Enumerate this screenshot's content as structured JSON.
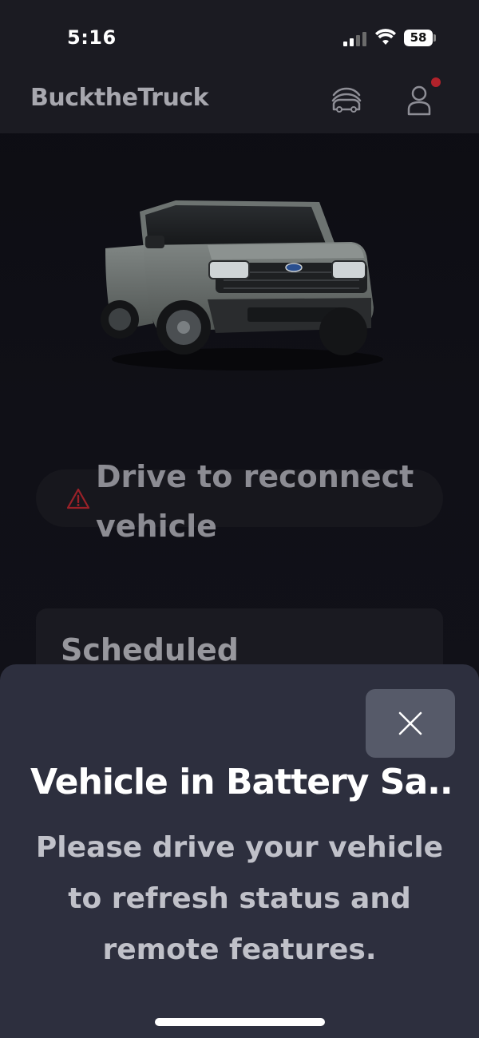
{
  "status_bar": {
    "time": "5:16",
    "battery_level": "58"
  },
  "header": {
    "brand": "BucktheTruck",
    "garage_icon": "car-garage-icon",
    "profile_icon": "user-profile-icon",
    "notification_color": "#b1222b"
  },
  "vehicle": {
    "image": "pickup-truck-image"
  },
  "alert": {
    "icon": "warning-triangle-icon",
    "text": "Drive to reconnect vehicle"
  },
  "scheduled": {
    "title": "Scheduled"
  },
  "sheet": {
    "close_icon": "close-icon",
    "title": "Vehicle in Battery Sa...",
    "message": "Please drive your vehicle to refresh status and remote features."
  },
  "colors": {
    "background": "#0f0f14",
    "header": "#1b1b22",
    "sheet": "#2d2f3e",
    "close_button": "#565a69",
    "warning": "#b1222b"
  }
}
